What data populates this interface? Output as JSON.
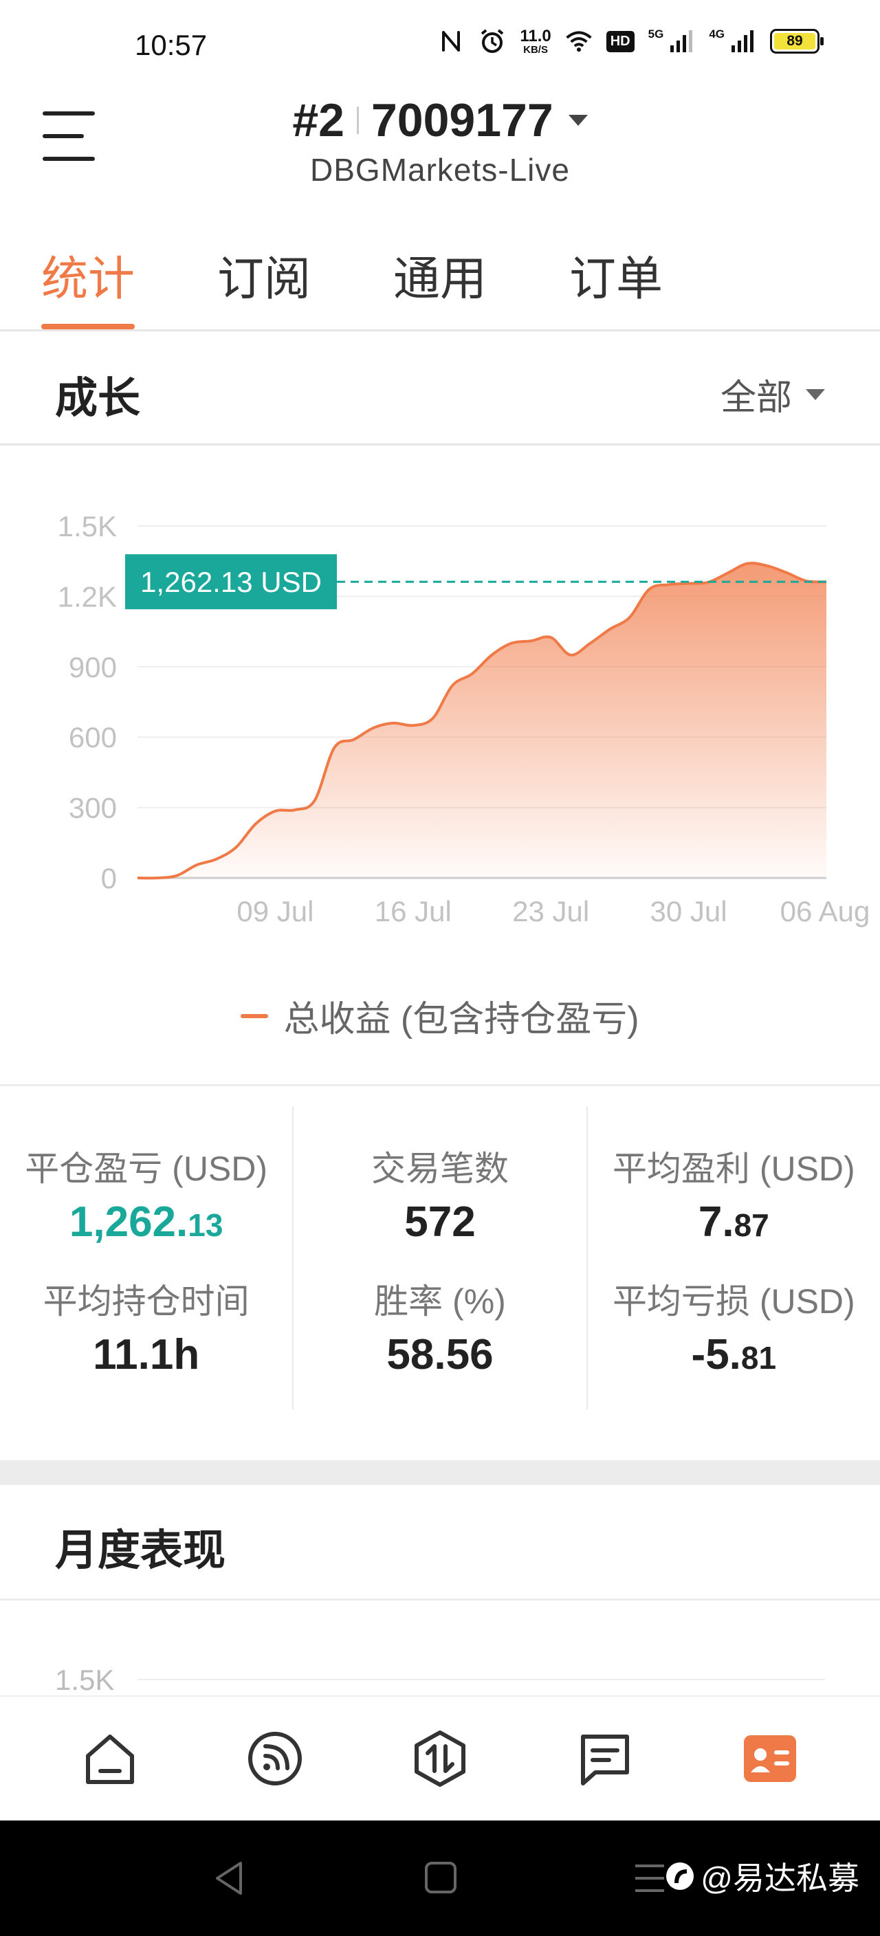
{
  "status_bar": {
    "time": "10:57",
    "net_speed": "11.0",
    "net_speed_unit": "KB/S",
    "hd_label": "HD",
    "net1": "5G",
    "net2": "4G",
    "battery": "89",
    "icons": [
      "nfc-icon",
      "alarm-icon",
      "wifi-icon",
      "signal-icon"
    ]
  },
  "header": {
    "account_index": "#2",
    "account_number": "7009177",
    "server": "DBGMarkets-Live"
  },
  "tabs": [
    {
      "label": "统计",
      "active": true
    },
    {
      "label": "订阅",
      "active": false
    },
    {
      "label": "通用",
      "active": false
    },
    {
      "label": "订单",
      "active": false
    }
  ],
  "growth": {
    "title": "成长",
    "filter": "全部"
  },
  "chart_data": {
    "type": "area",
    "title": "",
    "y_ticks": [
      "1.5K",
      "1.2K",
      "900",
      "600",
      "300",
      "0"
    ],
    "x_ticks": [
      "09 Jul",
      "16 Jul",
      "23 Jul",
      "30 Jul",
      "06 Aug"
    ],
    "ylim": [
      0,
      1500
    ],
    "current_value_label": "1,262.13 USD",
    "current_value": 1262.13,
    "legend": "总收益 (包含持仓盈亏)",
    "color": "#f07a47",
    "marker_color": "#19a89a",
    "series": [
      {
        "name": "总收益 (包含持仓盈亏)",
        "x": [
          "2024-07-02",
          "2024-07-03",
          "2024-07-04",
          "2024-07-05",
          "2024-07-06",
          "2024-07-07",
          "2024-07-08",
          "2024-07-09",
          "2024-07-10",
          "2024-07-11",
          "2024-07-12",
          "2024-07-13",
          "2024-07-14",
          "2024-07-15",
          "2024-07-16",
          "2024-07-17",
          "2024-07-18",
          "2024-07-19",
          "2024-07-20",
          "2024-07-21",
          "2024-07-22",
          "2024-07-23",
          "2024-07-24",
          "2024-07-25",
          "2024-07-26",
          "2024-07-27",
          "2024-07-28",
          "2024-07-29",
          "2024-07-30",
          "2024-07-31",
          "2024-08-01",
          "2024-08-02",
          "2024-08-03",
          "2024-08-04",
          "2024-08-05",
          "2024-08-06"
        ],
        "y": [
          0,
          0,
          10,
          55,
          80,
          130,
          230,
          285,
          290,
          330,
          555,
          590,
          640,
          660,
          650,
          680,
          820,
          870,
          950,
          1000,
          1010,
          1025,
          950,
          1000,
          1060,
          1110,
          1230,
          1250,
          1255,
          1260,
          1300,
          1340,
          1330,
          1300,
          1265,
          1262
        ]
      }
    ]
  },
  "stats": {
    "closed_pl": {
      "label": "平仓盈亏 (USD)",
      "int": "1,262.",
      "dec": "13"
    },
    "avg_hold": {
      "label": "平均持仓时间",
      "value": "11.1h"
    },
    "trades": {
      "label": "交易笔数",
      "value": "572"
    },
    "win_rate": {
      "label": "胜率 (%)",
      "value": "58.56"
    },
    "avg_profit": {
      "label": "平均盈利 (USD)",
      "int": "7.",
      "dec": "87"
    },
    "avg_loss": {
      "label": "平均亏损 (USD)",
      "int": "-5.",
      "dec": "81"
    }
  },
  "monthly": {
    "title": "月度表现",
    "top_tick": "1.5K"
  },
  "bottom_nav": [
    "home-icon",
    "feed-icon",
    "trade-icon",
    "chat-icon",
    "profile-card-icon"
  ],
  "watermark": "@易达私募"
}
